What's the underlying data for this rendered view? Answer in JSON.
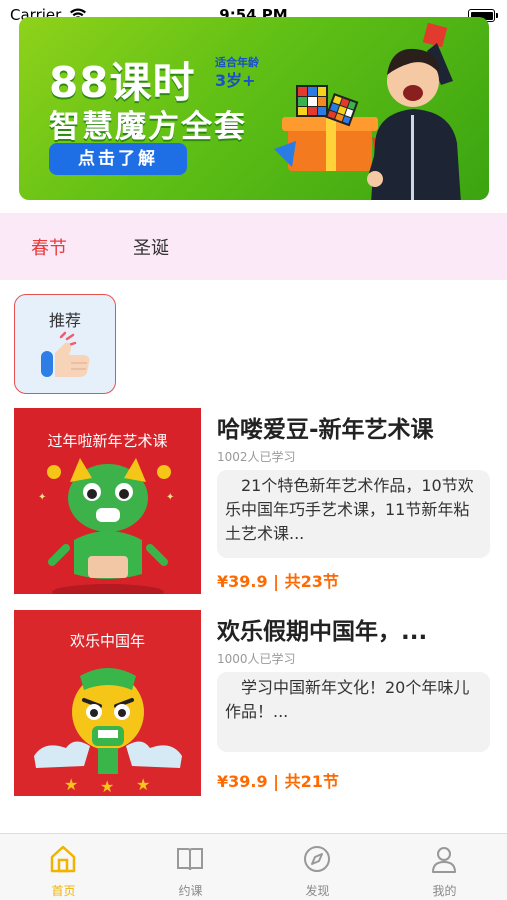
{
  "status_bar": {
    "carrier": "Carrier",
    "time": "9:54 PM"
  },
  "banner": {
    "headline": "88课时",
    "subline": "智慧魔方全套",
    "age_label": "适合年龄",
    "age_value": "3岁+",
    "cta": "点击了解"
  },
  "categories": [
    {
      "label": "春节",
      "active": true
    },
    {
      "label": "圣诞",
      "active": false
    }
  ],
  "recommend": {
    "label": "推荐",
    "icon": "thumbs-up-icon"
  },
  "courses": [
    {
      "thumb_title": "过年啦新年艺术课",
      "title": "哈喽爱豆-新年艺术课",
      "learners": "1002人已学习",
      "description": "21个特色新年艺术作品，10节欢乐中国年巧手艺术课，11节新年粘土艺术课...",
      "price": "¥39.9 | 共23节"
    },
    {
      "thumb_title": "欢乐中国年",
      "title": "欢乐假期中国年，...",
      "learners": "1000人已学习",
      "description": "学习中国新年文化！20个年味儿作品！...",
      "price": "¥39.9 | 共21节"
    }
  ],
  "tabbar": [
    {
      "label": "首页",
      "icon": "home-icon",
      "active": true
    },
    {
      "label": "约课",
      "icon": "book-icon",
      "active": false
    },
    {
      "label": "发现",
      "icon": "compass-icon",
      "active": false
    },
    {
      "label": "我的",
      "icon": "person-icon",
      "active": false
    }
  ],
  "colors": {
    "accent": "#f0b400",
    "price": "#ff6a00",
    "active_category": "#e83a3a",
    "banner_green": "#5fbf15"
  }
}
